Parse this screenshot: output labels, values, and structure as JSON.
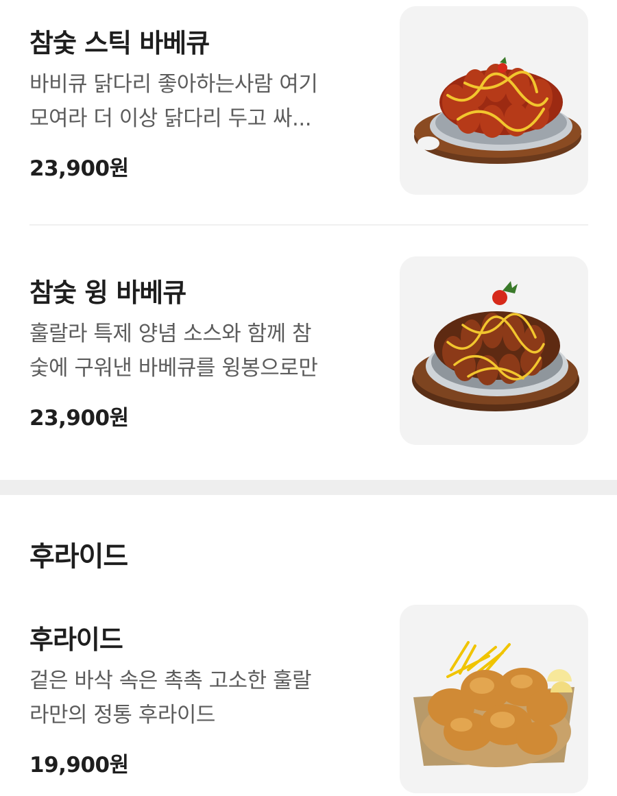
{
  "menu_items": [
    {
      "name": "참숯 스틱 바베큐",
      "desc_line1": "바비큐 닭다리 좋아하는사람 여기",
      "desc_line2": "모여라 더 이상 닭다리 두고 싸...",
      "price": "23,900원",
      "image_icon": "bbq-drumstick-dish-image"
    },
    {
      "name": "참숯 윙 바베큐",
      "desc_line1": "훌랄라 특제 양념 소스와 함께 참",
      "desc_line2": "숯에 구워낸 바베큐를 윙봉으로만",
      "price": "23,900원",
      "image_icon": "bbq-wing-dish-image"
    }
  ],
  "section": {
    "title": "후라이드",
    "items": [
      {
        "name": "후라이드",
        "desc_line1": "겉은 바삭 속은 촉촉 고소한 훌랄",
        "desc_line2": "라만의 정통 후라이드",
        "price": "19,900원",
        "image_icon": "fried-chicken-basket-image"
      }
    ]
  },
  "colors": {
    "background": "#ffffff",
    "text_primary": "#1e1e1e",
    "text_secondary": "#5c5c5c",
    "thumb_bg": "#f3f3f3",
    "section_gap": "#eeeeee"
  }
}
